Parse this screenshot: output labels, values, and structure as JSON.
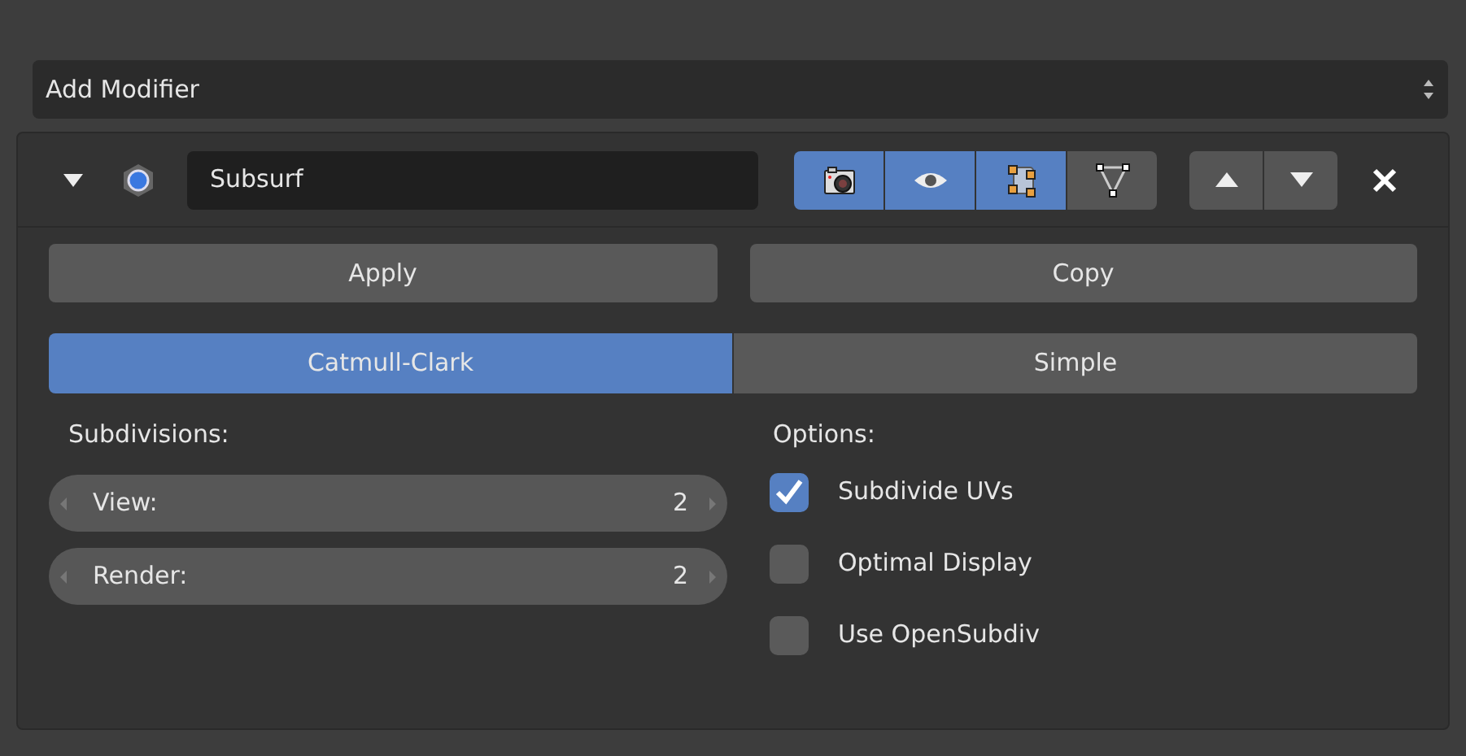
{
  "add_modifier": {
    "label": "Add Modifier"
  },
  "modifier": {
    "expanded": true,
    "name": "Subsurf",
    "visibility_toggles": [
      {
        "kind": "camera",
        "on": true
      },
      {
        "kind": "eye",
        "on": true
      },
      {
        "kind": "editmode",
        "on": true
      },
      {
        "kind": "cage",
        "on": false
      }
    ],
    "actions": [
      "Apply",
      "Copy"
    ],
    "tabs": [
      {
        "label": "Catmull-Clark",
        "selected": true
      },
      {
        "label": "Simple",
        "selected": false
      }
    ],
    "subdivisions": {
      "label": "Subdivisions:",
      "fields": [
        {
          "label": "View:",
          "value": "2"
        },
        {
          "label": "Render:",
          "value": "2"
        }
      ]
    },
    "options": {
      "label": "Options:",
      "items": [
        {
          "label": "Subdivide UVs",
          "checked": true
        },
        {
          "label": "Optimal Display",
          "checked": false
        },
        {
          "label": "Use OpenSubdiv",
          "checked": false
        }
      ]
    }
  }
}
